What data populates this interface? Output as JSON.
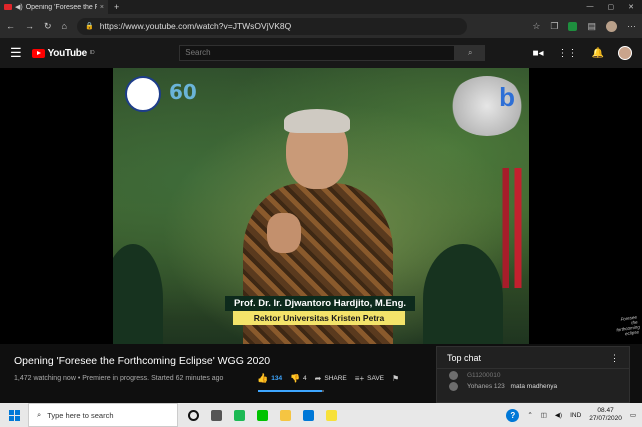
{
  "browser": {
    "tab_title": "Opening 'Foresee the Fourth",
    "tab_close": "×",
    "new_tab": "+",
    "window_controls": [
      "—",
      "▢",
      "✕"
    ],
    "url": "https://www.youtube.com/watch?v=JTWsOVjVK8Q",
    "nav": [
      "←",
      "→",
      "↻",
      "⌂"
    ]
  },
  "youtube_header": {
    "logo_text": "YouTube",
    "logo_sup": "ID",
    "search_placeholder": "Search",
    "search_button": "⌕",
    "icons": [
      "create-video-icon",
      "apps-icon",
      "notifications-icon",
      "avatar"
    ]
  },
  "video": {
    "presenter_name": "Prof. Dr. Ir. Djwantoro Hardjito, M.Eng.",
    "presenter_role": "Rektor Universitas Kristen Petra",
    "badge_number": "60",
    "corner_logo": "b",
    "watermark_text": "Foresee the forthcoming eclipse"
  },
  "info": {
    "title": "Opening 'Foresee the Forthcoming Eclipse' WGG 2020",
    "meta": "1,472 watching now • Premiere in progress. Started 62 minutes ago",
    "like_count": "134",
    "dislike_count": "4",
    "share_label": "SHARE",
    "save_label": "SAVE",
    "like_ratio": 0.97
  },
  "chat": {
    "title": "Top chat",
    "menu": "⋮",
    "messages": [
      {
        "author": "",
        "text": "G11200010",
        "faded": true
      },
      {
        "author": "Yohanes 123",
        "text": "mata madhenya",
        "faded": false
      }
    ]
  },
  "taskbar": {
    "search_placeholder": "Type here to search",
    "language": "IND",
    "time": "08.47",
    "date": "27/07/2020",
    "apps": [
      {
        "name": "cortana-icon",
        "color": "#111111"
      },
      {
        "name": "task-view-icon",
        "color": "#555555"
      },
      {
        "name": "spotify-icon",
        "color": "#1db954"
      },
      {
        "name": "line-icon",
        "color": "#00c300"
      },
      {
        "name": "file-explorer-icon",
        "color": "#f5c542"
      },
      {
        "name": "edge-icon",
        "color": "#0078d7"
      },
      {
        "name": "sticky-notes-icon",
        "color": "#f7e13a"
      }
    ]
  },
  "colors": {
    "accent": "#3ea6ff",
    "youtube_red": "#ff0000",
    "lower_third_yellow": "#f3e36a"
  }
}
